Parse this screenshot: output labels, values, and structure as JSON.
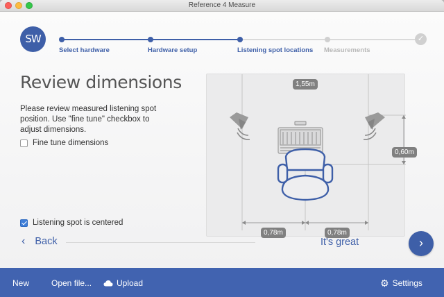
{
  "window": {
    "title": "Reference 4 Measure"
  },
  "logo": {
    "text": "SW"
  },
  "steps": [
    {
      "label": "Select hardware",
      "state": "done"
    },
    {
      "label": "Hardware setup",
      "state": "done"
    },
    {
      "label": "Listening spot locations",
      "state": "current"
    },
    {
      "label": "Measurements",
      "state": "pending"
    }
  ],
  "main": {
    "title": "Review dimensions",
    "instructions": "Please review measured listening spot position. Use \"fine tune\" checkbox to adjust dimensions.",
    "fine_tune": {
      "label": "Fine tune dimensions",
      "checked": false
    },
    "centered": {
      "label": "Listening spot is centered",
      "checked": true
    }
  },
  "diagram": {
    "width_label": "1,55m",
    "depth_label": "0,60m",
    "left_label": "0,78m",
    "right_label": "0,78m"
  },
  "nav": {
    "back_label": "Back",
    "confirm_label": "It's great",
    "next_icon": "chevron-right-icon"
  },
  "footer": {
    "new_label": "New",
    "open_label": "Open file...",
    "upload_label": "Upload",
    "settings_label": "Settings"
  },
  "colors": {
    "accent": "#3e5fa8",
    "footer": "#4163b0",
    "pending": "#d0d0d0",
    "badge": "#808080"
  }
}
